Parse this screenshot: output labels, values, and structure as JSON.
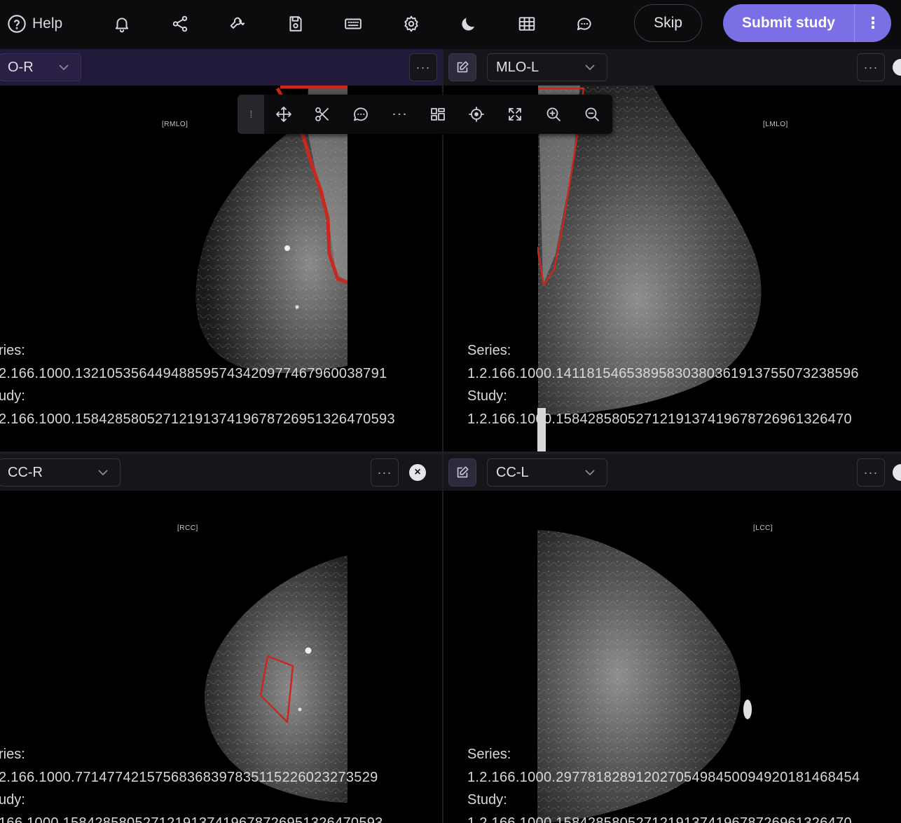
{
  "toolbar": {
    "help_label": "Help",
    "icons": [
      "help-icon",
      "bell-icon",
      "share-icon",
      "wrench-icon",
      "save-icon",
      "keyboard-icon",
      "gear-icon",
      "moon-icon",
      "grid-icon",
      "chat-icon"
    ],
    "skip_label": "Skip",
    "submit_label": "Submit study",
    "more_label": "⋮"
  },
  "palette": {
    "tools": [
      "move-icon",
      "scissors-icon",
      "comment-icon",
      "more-horizontal-icon",
      "layout-icon",
      "crosshair-icon",
      "fullscreen-icon",
      "zoom-in-icon",
      "zoom-out-icon"
    ]
  },
  "viewports": [
    {
      "view": "O-R",
      "menu": "···",
      "orientation": "RMLO",
      "series_label": "ries:",
      "series_value": "2.166.1000.132105356449488595743420977467960038791",
      "study_label": "udy:",
      "study_value": "2.166.1000.1584285805271219137419678726951326470593"
    },
    {
      "view": "MLO-L",
      "menu": "···",
      "orientation": "LMLO",
      "series_label": "Series:",
      "series_value": "1.2.166.1000.14118154653895830380361913755073238596",
      "study_label": "Study:",
      "study_value": "1.2.166.1000.1584285805271219137419678726961326470"
    },
    {
      "view": "CC-R",
      "menu": "···",
      "close": "×",
      "orientation": "RCC",
      "series_label": "ries:",
      "series_value": "2.166.1000.771477421575683683978351152260232735​29",
      "study_label": "udy:",
      "study_value": "166.1000.1584285805271219137419678726951326470593"
    },
    {
      "view": "CC-L",
      "menu": "···",
      "orientation": "LCC",
      "series_label": "Series:",
      "series_value": "1.2.166.1000.29778182891202705498450094920181468454",
      "study_label": "Study:",
      "study_value": "1.2.166.1000.1584285805271219137419678726961326470"
    }
  ],
  "colors": {
    "accent": "#7b6fe6",
    "annotation": "#c8281e",
    "active_header": "#221a3a"
  }
}
